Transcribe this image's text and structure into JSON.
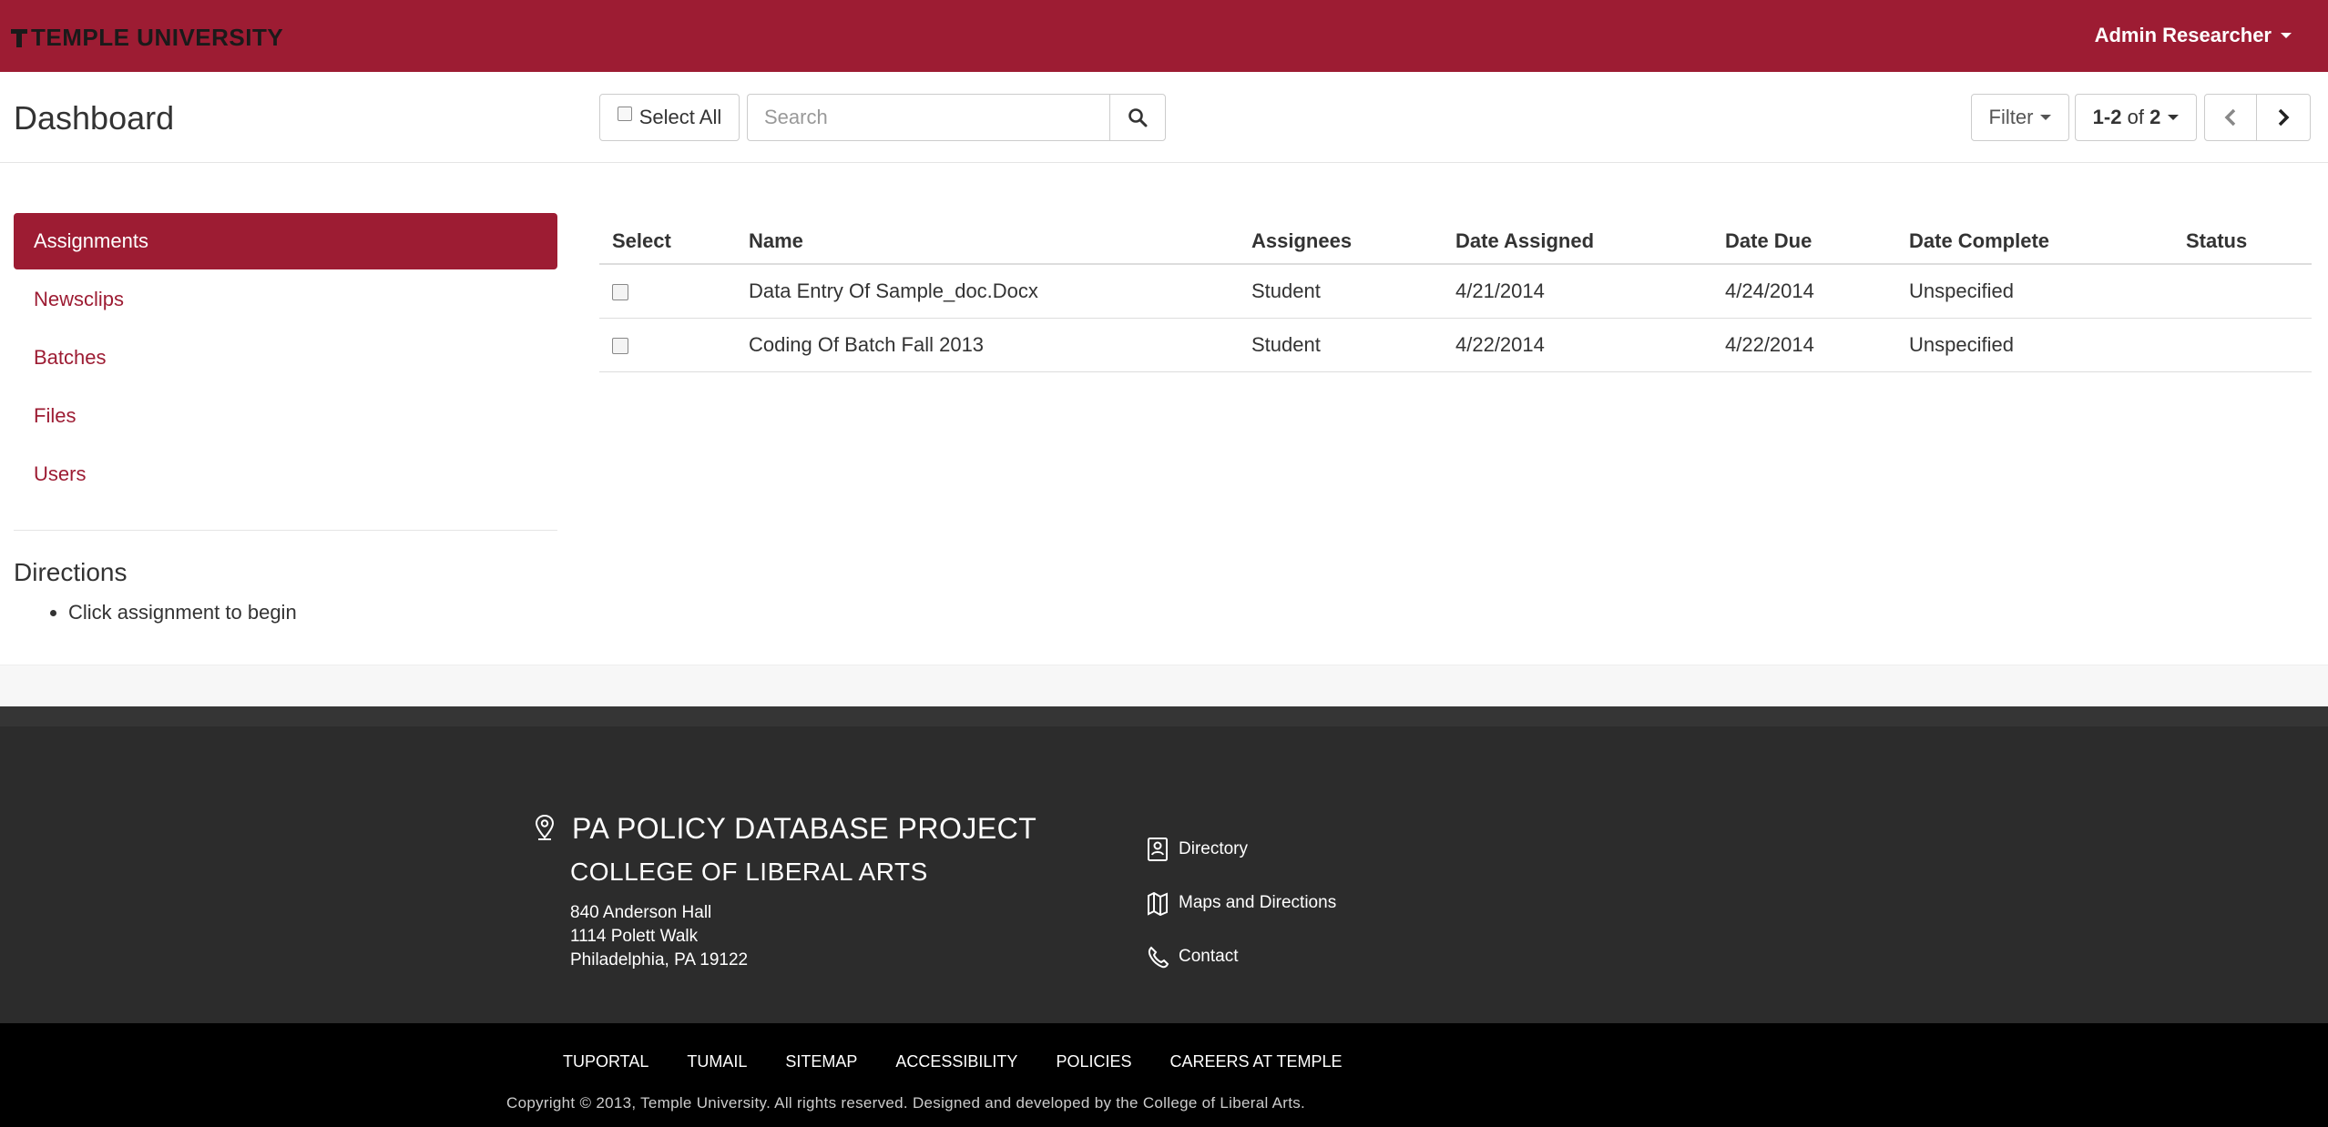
{
  "header": {
    "brand": "TEMPLE UNIVERSITY",
    "user_menu": "Admin Researcher"
  },
  "toolbar": {
    "page_title": "Dashboard",
    "select_all_label": "Select All",
    "search_placeholder": "Search",
    "filter_label": "Filter",
    "pager_range": "1-2",
    "pager_of": "of",
    "pager_total": "2"
  },
  "sidebar": {
    "items": [
      {
        "label": "Assignments",
        "active": true
      },
      {
        "label": "Newsclips"
      },
      {
        "label": "Batches"
      },
      {
        "label": "Files"
      },
      {
        "label": "Users"
      }
    ],
    "directions_title": "Directions",
    "directions": [
      "Click assignment to begin"
    ]
  },
  "table": {
    "headers": [
      "Select",
      "Name",
      "Assignees",
      "Date Assigned",
      "Date Due",
      "Date Complete",
      "Status"
    ],
    "rows": [
      {
        "name": "Data Entry Of Sample_doc.Docx",
        "assignees": "Student",
        "date_assigned": "4/21/2014",
        "date_due": "4/24/2014",
        "date_complete": "Unspecified",
        "status": ""
      },
      {
        "name": "Coding Of Batch Fall 2013",
        "assignees": "Student",
        "date_assigned": "4/22/2014",
        "date_due": "4/22/2014",
        "date_complete": "Unspecified",
        "status": ""
      }
    ]
  },
  "footer": {
    "project": "PA POLICY DATABASE PROJECT",
    "college": "COLLEGE OF LIBERAL ARTS",
    "address": [
      "840 Anderson Hall",
      "1114 Polett Walk",
      "Philadelphia, PA 19122"
    ],
    "links": [
      {
        "label": "Directory",
        "icon": "directory-icon"
      },
      {
        "label": "Maps and Directions",
        "icon": "map-icon"
      },
      {
        "label": "Contact",
        "icon": "phone-icon"
      }
    ],
    "bottom_links": [
      "TUPORTAL",
      "TUMAIL",
      "SITEMAP",
      "ACCESSIBILITY",
      "POLICIES",
      "CAREERS AT TEMPLE"
    ],
    "copyright": "Copyright © 2013, Temple University. All rights reserved. Designed and developed by the College of Liberal Arts."
  },
  "colors": {
    "brand_red": "#9d1c33",
    "footer_dark": "#2c2c2c",
    "bottom_black": "#000000"
  }
}
